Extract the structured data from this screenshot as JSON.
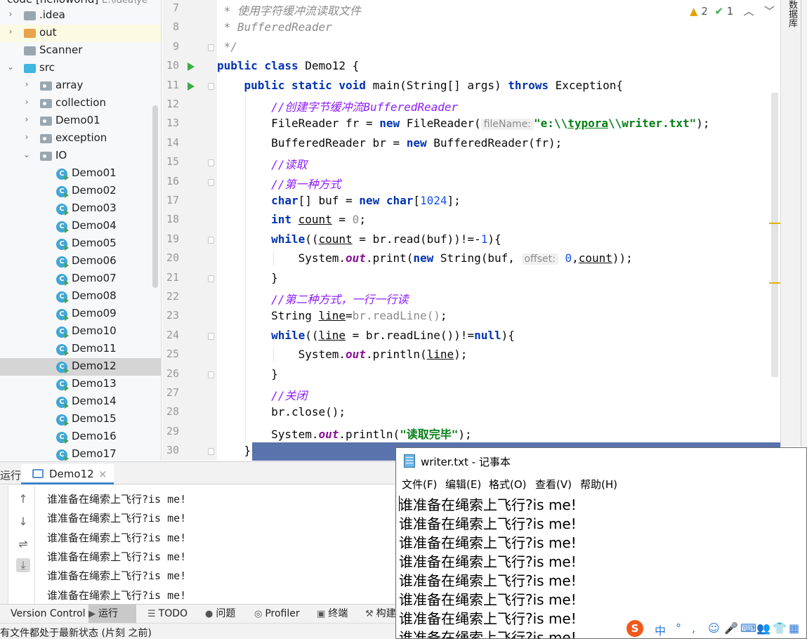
{
  "project": {
    "title": "code [helloworld]",
    "path": "E:\\idea\\ye",
    "items": [
      {
        "label": ".idea",
        "caret": "›",
        "indent": 0,
        "icon": "gray"
      },
      {
        "label": "out",
        "caret": "›",
        "indent": 0,
        "icon": "orange"
      },
      {
        "label": "Scanner",
        "caret": "",
        "indent": 0,
        "icon": "gray"
      },
      {
        "label": "src",
        "caret": "⌄",
        "indent": 0,
        "icon": "blue"
      },
      {
        "label": "array",
        "caret": "›",
        "indent": 1,
        "icon": "pkg"
      },
      {
        "label": "collection",
        "caret": "›",
        "indent": 1,
        "icon": "pkg"
      },
      {
        "label": "Demo01",
        "caret": "›",
        "indent": 1,
        "icon": "pkg"
      },
      {
        "label": "exception",
        "caret": "›",
        "indent": 1,
        "icon": "pkg"
      },
      {
        "label": "IO",
        "caret": "⌄",
        "indent": 1,
        "icon": "pkg"
      },
      {
        "label": "Demo01",
        "caret": "",
        "indent": 2,
        "icon": "class"
      },
      {
        "label": "Demo02",
        "caret": "",
        "indent": 2,
        "icon": "class"
      },
      {
        "label": "Demo03",
        "caret": "",
        "indent": 2,
        "icon": "class"
      },
      {
        "label": "Demo04",
        "caret": "",
        "indent": 2,
        "icon": "class"
      },
      {
        "label": "Demo05",
        "caret": "",
        "indent": 2,
        "icon": "class"
      },
      {
        "label": "Demo06",
        "caret": "",
        "indent": 2,
        "icon": "class"
      },
      {
        "label": "Demo07",
        "caret": "",
        "indent": 2,
        "icon": "class"
      },
      {
        "label": "Demo08",
        "caret": "",
        "indent": 2,
        "icon": "class"
      },
      {
        "label": "Demo09",
        "caret": "",
        "indent": 2,
        "icon": "class"
      },
      {
        "label": "Demo10",
        "caret": "",
        "indent": 2,
        "icon": "class"
      },
      {
        "label": "Demo11",
        "caret": "",
        "indent": 2,
        "icon": "class"
      },
      {
        "label": "Demo12",
        "caret": "",
        "indent": 2,
        "icon": "class",
        "selected": true
      },
      {
        "label": "Demo13",
        "caret": "",
        "indent": 2,
        "icon": "class"
      },
      {
        "label": "Demo14",
        "caret": "",
        "indent": 2,
        "icon": "class"
      },
      {
        "label": "Demo15",
        "caret": "",
        "indent": 2,
        "icon": "class"
      },
      {
        "label": "Demo16",
        "caret": "",
        "indent": 2,
        "icon": "class"
      },
      {
        "label": "Demo17",
        "caret": "",
        "indent": 2,
        "icon": "class"
      }
    ]
  },
  "editor": {
    "inspections": {
      "warnings": "2",
      "ok": "1"
    },
    "lines": [
      {
        "n": "7",
        "t": [
          [
            "cm",
            " * 使用字符缓冲流读取文件"
          ]
        ]
      },
      {
        "n": "8",
        "t": [
          [
            "cm",
            " * BufferedReader"
          ]
        ]
      },
      {
        "n": "9",
        "t": [
          [
            "cm",
            " */"
          ]
        ],
        "fold": true
      },
      {
        "n": "10",
        "t": [
          [
            "kw",
            "public class "
          ],
          [
            "",
            "Demo12 {"
          ]
        ],
        "run": true
      },
      {
        "n": "11",
        "t": [
          [
            "",
            "    "
          ],
          [
            "kw",
            "public static void "
          ],
          [
            "",
            "main(String[] args) "
          ],
          [
            "kw",
            "throws "
          ],
          [
            "",
            "Exception{"
          ]
        ],
        "run": true,
        "fold": true
      },
      {
        "n": "12",
        "t": [
          [
            "",
            "        "
          ],
          [
            "cc",
            "//创建字节缓冲流BufferedReader"
          ]
        ]
      },
      {
        "n": "13",
        "t": [
          [
            "",
            "        FileReader fr = "
          ],
          [
            "kw",
            "new "
          ],
          [
            "",
            "FileReader("
          ],
          [
            "hint",
            "fileName:"
          ],
          [
            "str",
            "\"e:\\\\"
          ],
          [
            "str und",
            "typora"
          ],
          [
            "str",
            "\\\\writer.txt\""
          ],
          [
            "",
            ");"
          ]
        ]
      },
      {
        "n": "14",
        "t": [
          [
            "",
            "        BufferedReader br = "
          ],
          [
            "kw",
            "new "
          ],
          [
            "",
            "BufferedReader(fr);"
          ]
        ]
      },
      {
        "n": "15",
        "t": [
          [
            "",
            "        "
          ],
          [
            "cc",
            "//读取"
          ]
        ],
        "fold": true
      },
      {
        "n": "16",
        "t": [
          [
            "",
            "        "
          ],
          [
            "cc",
            "//第一种方式"
          ]
        ],
        "fold": true
      },
      {
        "n": "17",
        "t": [
          [
            "",
            "        "
          ],
          [
            "kw",
            "char"
          ],
          [
            "",
            "[] buf = "
          ],
          [
            "kw",
            "new char"
          ],
          [
            "",
            "["
          ],
          [
            "num",
            "1024"
          ],
          [
            "",
            "];"
          ]
        ]
      },
      {
        "n": "18",
        "t": [
          [
            "",
            "        "
          ],
          [
            "kw",
            "int "
          ],
          [
            "und",
            "count"
          ],
          [
            "",
            " = "
          ],
          [
            "gry",
            "0"
          ],
          [
            "",
            ";"
          ]
        ]
      },
      {
        "n": "19",
        "t": [
          [
            "",
            "        "
          ],
          [
            "kw",
            "while"
          ],
          [
            "",
            "(("
          ],
          [
            "und",
            "count"
          ],
          [
            "",
            " = br.read(buf))!=-"
          ],
          [
            "num",
            "1"
          ],
          [
            "",
            "){"
          ]
        ],
        "fold": true
      },
      {
        "n": "20",
        "t": [
          [
            "",
            "            System."
          ],
          [
            "fld",
            "out"
          ],
          [
            "",
            ".print("
          ],
          [
            "kw",
            "new "
          ],
          [
            "",
            "String(buf, "
          ],
          [
            "hint",
            "offset:"
          ],
          [
            "num",
            " 0"
          ],
          [
            "",
            ","
          ],
          [
            "und",
            "count"
          ],
          [
            "",
            "));"
          ]
        ]
      },
      {
        "n": "21",
        "t": [
          [
            "",
            "        }"
          ]
        ],
        "fold": true
      },
      {
        "n": "22",
        "t": [
          [
            "",
            "        "
          ],
          [
            "cc",
            "//第二种方式，一行一行读"
          ]
        ]
      },
      {
        "n": "23",
        "t": [
          [
            "",
            "        String "
          ],
          [
            "und",
            "line"
          ],
          [
            "",
            "="
          ],
          [
            "gry",
            "br.readLine()"
          ],
          [
            "",
            ";"
          ]
        ]
      },
      {
        "n": "24",
        "t": [
          [
            "",
            "        "
          ],
          [
            "kw",
            "while"
          ],
          [
            "",
            "(("
          ],
          [
            "und",
            "line"
          ],
          [
            "",
            " = br.readLine())!="
          ],
          [
            "kw",
            "null"
          ],
          [
            "",
            "){"
          ]
        ],
        "fold": true
      },
      {
        "n": "25",
        "t": [
          [
            "",
            "            System."
          ],
          [
            "fld",
            "out"
          ],
          [
            "",
            ".println("
          ],
          [
            "und",
            "line"
          ],
          [
            "",
            ");"
          ]
        ]
      },
      {
        "n": "26",
        "t": [
          [
            "",
            "        }"
          ]
        ],
        "fold": true
      },
      {
        "n": "27",
        "t": [
          [
            "",
            "        "
          ],
          [
            "cc",
            "//关闭"
          ]
        ]
      },
      {
        "n": "28",
        "t": [
          [
            "",
            "        br.close();"
          ]
        ]
      },
      {
        "n": "29",
        "t": [
          [
            "",
            "        System."
          ],
          [
            "fld",
            "out"
          ],
          [
            "",
            ".println("
          ],
          [
            "str",
            "\"读取完毕\""
          ],
          [
            "",
            ");"
          ]
        ]
      },
      {
        "n": "30",
        "t": [
          [
            "",
            "    }"
          ]
        ],
        "fold": true
      }
    ]
  },
  "right_strip": {
    "label": "数据库"
  },
  "run_panel": {
    "label": "运行:",
    "tab": "Demo12",
    "close": "×",
    "output": [
      "谁准备在绳索上飞行?is me!",
      "谁准备在绳索上飞行?is me!",
      "谁准备在绳索上飞行?is me!",
      "谁准备在绳索上飞行?is me!",
      "谁准备在绳索上飞行?is me!",
      "谁准备在绳索上飞行?is me!"
    ]
  },
  "toolbar": {
    "items": [
      {
        "label": "Version Control",
        "icon": ""
      },
      {
        "label": "运行",
        "icon": "▶",
        "active": true
      },
      {
        "label": "TODO",
        "icon": "☰"
      },
      {
        "label": "问题",
        "icon": "●"
      },
      {
        "label": "Profiler",
        "icon": "◎"
      },
      {
        "label": "终端",
        "icon": "▣"
      },
      {
        "label": "构建",
        "icon": "⚒"
      }
    ]
  },
  "status": {
    "text": "有文件都处于最新状态 (片刻 之前)"
  },
  "notepad": {
    "title": "writer.txt - 记事本",
    "menu": [
      "文件(F)",
      "编辑(E)",
      "格式(O)",
      "查看(V)",
      "帮助(H)"
    ],
    "lines": [
      "谁准备在绳索上飞行?is me!",
      "谁准备在绳索上飞行?is me!",
      "谁准备在绳索上飞行?is me!",
      "谁准备在绳索上飞行?is me!",
      "谁准备在绳索上飞行?is me!",
      "谁准备在绳索上飞行?is me!",
      "谁准备在绳索上飞行?is me!",
      "谁准备在绳索上飞行?is me!"
    ]
  },
  "ime": {
    "logo": "S",
    "lang": "中",
    "items": [
      "°",
      ",",
      "☺",
      "🎤",
      "⌨",
      "👥",
      "👕",
      "▦"
    ]
  },
  "colors": {
    "accent": "#4083c9",
    "run_green": "#3daa4a",
    "selection": "#5a73ac",
    "warning": "#e2a400"
  }
}
